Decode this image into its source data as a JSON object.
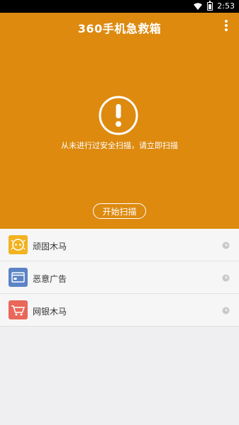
{
  "status_bar": {
    "time": "2:53"
  },
  "header": {
    "title": "360手机急救箱"
  },
  "hero": {
    "message": "从未进行过安全扫描，请立即扫描",
    "scan_button_label": "开始扫描"
  },
  "items": [
    {
      "label": "顽固木马",
      "icon": "trojan-icon",
      "color": "#f2b31f"
    },
    {
      "label": "恶意广告",
      "icon": "ad-icon",
      "color": "#5b84c6"
    },
    {
      "label": "网银木马",
      "icon": "bank-trojan-icon",
      "color": "#e8675a"
    }
  ],
  "colors": {
    "accent": "#dd8a0f"
  }
}
